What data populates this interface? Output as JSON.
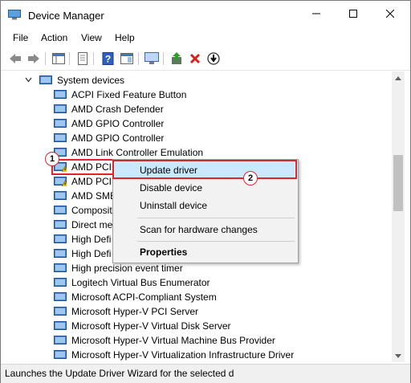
{
  "window": {
    "title": "Device Manager"
  },
  "menubar": {
    "file": "File",
    "action": "Action",
    "view": "View",
    "help": "Help"
  },
  "tree": {
    "category": "System devices",
    "devices": [
      "ACPI Fixed Feature Button",
      "AMD Crash Defender",
      "AMD GPIO Controller",
      "AMD GPIO Controller",
      "AMD Link Controller Emulation",
      "AMD PCI",
      "AMD PCI",
      "AMD SMB",
      "Composit",
      "Direct me",
      "High Defi",
      "High Defi",
      "High precision event timer",
      "Logitech Virtual Bus Enumerator",
      "Microsoft ACPI-Compliant System",
      "Microsoft Hyper-V PCI Server",
      "Microsoft Hyper-V Virtual Disk Server",
      "Microsoft Hyper-V Virtual Machine Bus Provider",
      "Microsoft Hyper-V Virtualization Infrastructure Driver"
    ]
  },
  "context_menu": {
    "update_driver": "Update driver",
    "disable_device": "Disable device",
    "uninstall_device": "Uninstall device",
    "scan": "Scan for hardware changes",
    "properties": "Properties"
  },
  "annotations": {
    "step1": "1",
    "step2": "2"
  },
  "status": {
    "text": "Launches the Update Driver Wizard for the selected d"
  },
  "colors": {
    "highlight_border": "#e0232d",
    "menu_hover": "#cce8ff",
    "warning": "#f2c200"
  }
}
